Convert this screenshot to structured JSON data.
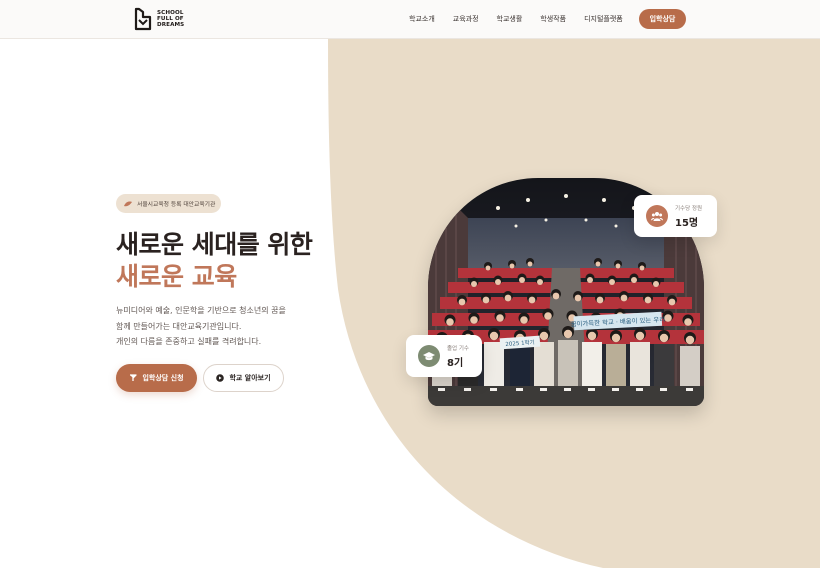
{
  "header": {
    "logo_lines": [
      "SCHOOL",
      "FULL OF",
      "DREAMS"
    ],
    "nav": [
      "학교소개",
      "교육과정",
      "학교생활",
      "학생작품",
      "디지털플랫폼"
    ],
    "cta_label": "입학상담"
  },
  "hero": {
    "badge_text": "서울시교육청 등록 대안교육기관",
    "title_line1": "새로운 세대를 위한",
    "title_line2": "새로운 교육",
    "description": [
      "뉴미디어와 예술, 인문학을 기반으로 청소년의 꿈을",
      "함께 만들어가는 대안교육기관입니다.",
      "개인의 다름을 존중하고 실패를 격려합니다."
    ],
    "primary_button": "입학상담 신청",
    "secondary_button": "학교 알아보기"
  },
  "stats": {
    "class_size": {
      "label": "기수당 정원",
      "value": "15명",
      "icon": "group-icon"
    },
    "graduates": {
      "label": "졸업 기수",
      "value": "8기",
      "icon": "graduation-cap-icon"
    }
  },
  "photo": {
    "banner_text": "꿈이가득한 학교 · 배움이 있는 우리",
    "sign_text": "2025 1학기"
  },
  "colors": {
    "accent": "#b86c4a",
    "accent_text": "#c0775a",
    "beige_bg": "#e9dcc8",
    "badge_bg": "#ede1d2",
    "class_icon_bg": "#c0775a",
    "grad_icon_bg": "#7d8b72"
  }
}
